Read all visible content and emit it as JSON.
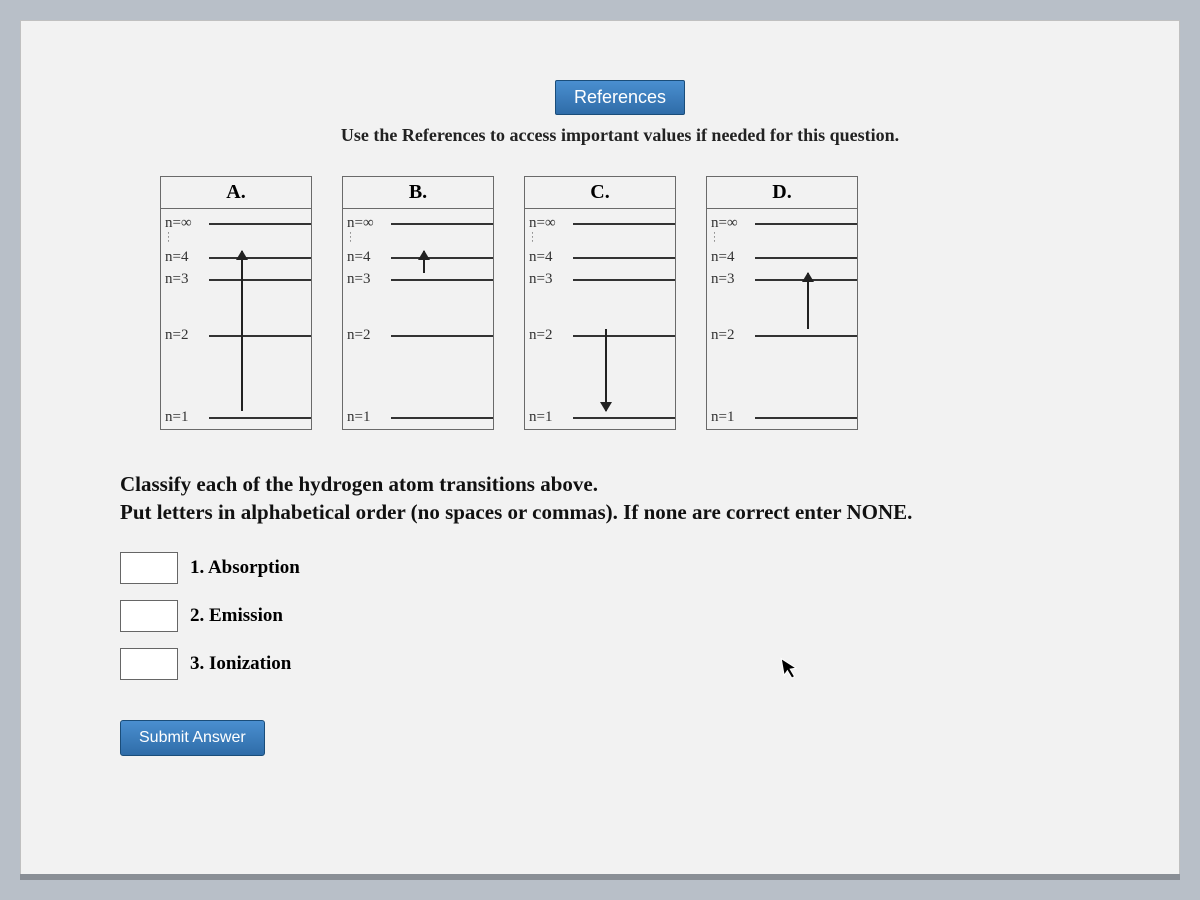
{
  "references_button": "References",
  "references_note": "Use the References to access important values if needed for this question.",
  "panels": {
    "a": "A.",
    "b": "B.",
    "c": "C.",
    "d": "D."
  },
  "levels": {
    "inf": "n=∞",
    "n4": "n=4",
    "n3": "n=3",
    "n2": "n=2",
    "n1": "n=1"
  },
  "prompt_line1": "Classify each of the hydrogen atom transitions above.",
  "prompt_line2": "Put letters in alphabetical order (no spaces or commas). If none are correct enter NONE.",
  "answers": {
    "absorption": "1. Absorption",
    "emission": "2. Emission",
    "ionization": "3. Ionization"
  },
  "submit": "Submit Answer"
}
